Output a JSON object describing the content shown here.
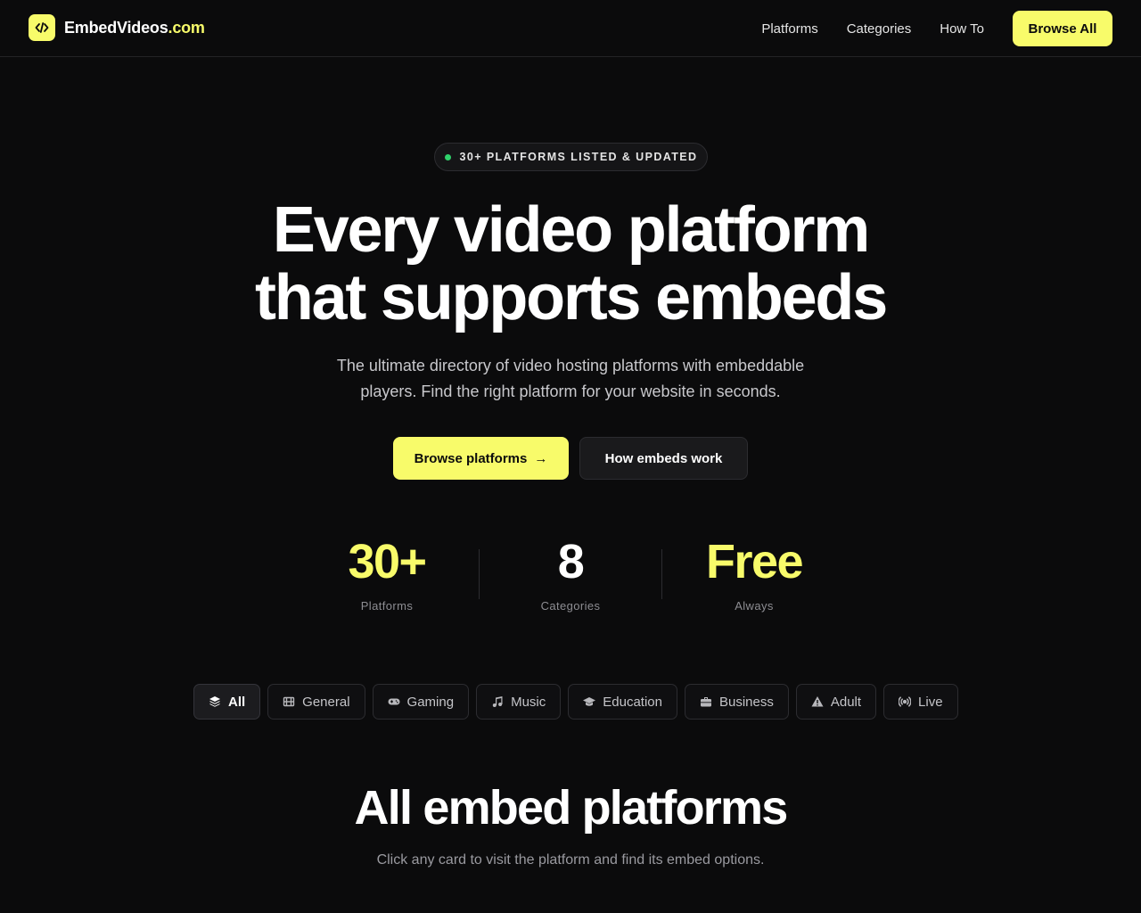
{
  "header": {
    "logo_main": "EmbedVideos",
    "logo_tld": ".com",
    "nav": [
      "Platforms",
      "Categories",
      "How To"
    ],
    "cta": "Browse All"
  },
  "hero": {
    "badge": "30+ PLATFORMS LISTED & UPDATED",
    "title_line1": "Every video platform",
    "title_line2": "that supports embeds",
    "subtitle_line1": "The ultimate directory of video hosting platforms with embeddable",
    "subtitle_line2": "players. Find the right platform for your website in seconds.",
    "primary_button": "Browse platforms",
    "primary_arrow": "→",
    "secondary_button": "How embeds work"
  },
  "stats": [
    {
      "value": "30+",
      "label": "Platforms"
    },
    {
      "value": "8",
      "label": "Categories"
    },
    {
      "value": "Free",
      "label": "Always"
    }
  ],
  "filters": [
    {
      "label": "All",
      "icon": "layers-icon",
      "active": true
    },
    {
      "label": "General",
      "icon": "film-icon",
      "active": false
    },
    {
      "label": "Gaming",
      "icon": "gamepad-icon",
      "active": false
    },
    {
      "label": "Music",
      "icon": "music-note-icon",
      "active": false
    },
    {
      "label": "Education",
      "icon": "graduation-cap-icon",
      "active": false
    },
    {
      "label": "Business",
      "icon": "briefcase-icon",
      "active": false
    },
    {
      "label": "Adult",
      "icon": "warning-icon",
      "active": false
    },
    {
      "label": "Live",
      "icon": "broadcast-icon",
      "active": false
    }
  ],
  "section": {
    "title": "All embed platforms",
    "subtitle": "Click any card to visit the platform and find its embed options."
  },
  "colors": {
    "accent": "#f8fb6a",
    "background": "#0b0b0c",
    "badge_dot": "#2fd26b"
  }
}
